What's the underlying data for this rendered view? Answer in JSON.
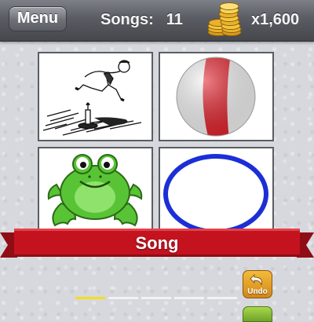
{
  "header": {
    "menu_label": "Menu",
    "songs_label": "Songs:",
    "songs_count": "11",
    "coins_label": "x1,600",
    "coins_icon": "gold-coins-icon"
  },
  "tiles": [
    {
      "name": "tile-jumping-boy",
      "description_icon": "boy-jumping-candlestick-icon"
    },
    {
      "name": "tile-beach-ball",
      "description_icon": "beach-ball-icon"
    },
    {
      "name": "tile-frog",
      "description_icon": "frog-icon"
    },
    {
      "name": "tile-circle",
      "description_icon": "blue-circle-icon"
    }
  ],
  "banner": {
    "label": "Song"
  },
  "answer": {
    "slots_total": 5,
    "slots_filled": 1
  },
  "undo": {
    "label": "Undo"
  },
  "colors": {
    "topbar": "#5a5c63",
    "banner": "#c4131f",
    "active_slot": "#f2e01b",
    "circle_blue": "#1c2fd6",
    "frog_green": "#58c435"
  }
}
